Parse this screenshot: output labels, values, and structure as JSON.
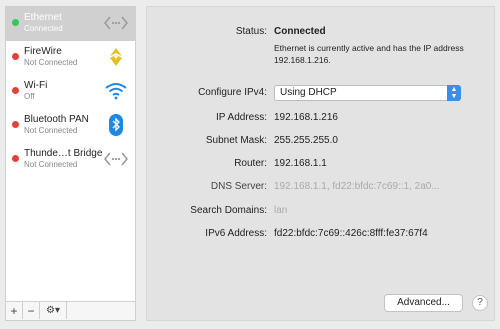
{
  "colors": {
    "connected": "#34c759",
    "not_connected": "#e0413a",
    "selection": "#d0d0d0",
    "accent": "#3b8eea",
    "wifi": "#1e88e5"
  },
  "services": [
    {
      "name": "Ethernet",
      "status": "Connected",
      "state": "connected",
      "icon": "ethernet-arrows-icon"
    },
    {
      "name": "FireWire",
      "status": "Not Connected",
      "state": "not_connected",
      "icon": "firewire-icon"
    },
    {
      "name": "Wi-Fi",
      "status": "Off",
      "state": "not_connected",
      "icon": "wifi-icon"
    },
    {
      "name": "Bluetooth PAN",
      "status": "Not Connected",
      "state": "not_connected",
      "icon": "bluetooth-icon"
    },
    {
      "name": "Thunde…t Bridge",
      "status": "Not Connected",
      "state": "not_connected",
      "icon": "thunderbolt-bridge-icon"
    }
  ],
  "sidebar_footer": {
    "add": "+",
    "remove": "−",
    "action": "⚙▾"
  },
  "detail": {
    "status_label": "Status:",
    "status_value": "Connected",
    "status_description": "Ethernet is currently active and has the IP address 192.168.1.216.",
    "configure_label": "Configure IPv4:",
    "configure_value": "Using DHCP",
    "ip_label": "IP Address:",
    "ip_value": "192.168.1.216",
    "subnet_label": "Subnet Mask:",
    "subnet_value": "255.255.255.0",
    "router_label": "Router:",
    "router_value": "192.168.1.1",
    "dns_label": "DNS Server:",
    "dns_value": "192.168.1.1, fd22:bfdc:7c69::1, 2a0...",
    "search_label": "Search Domains:",
    "search_value": "lan",
    "ipv6_label": "IPv6 Address:",
    "ipv6_value": "fd22:bfdc:7c69::426c:8fff:fe37:67f4",
    "advanced_button": "Advanced...",
    "help_button": "?"
  }
}
